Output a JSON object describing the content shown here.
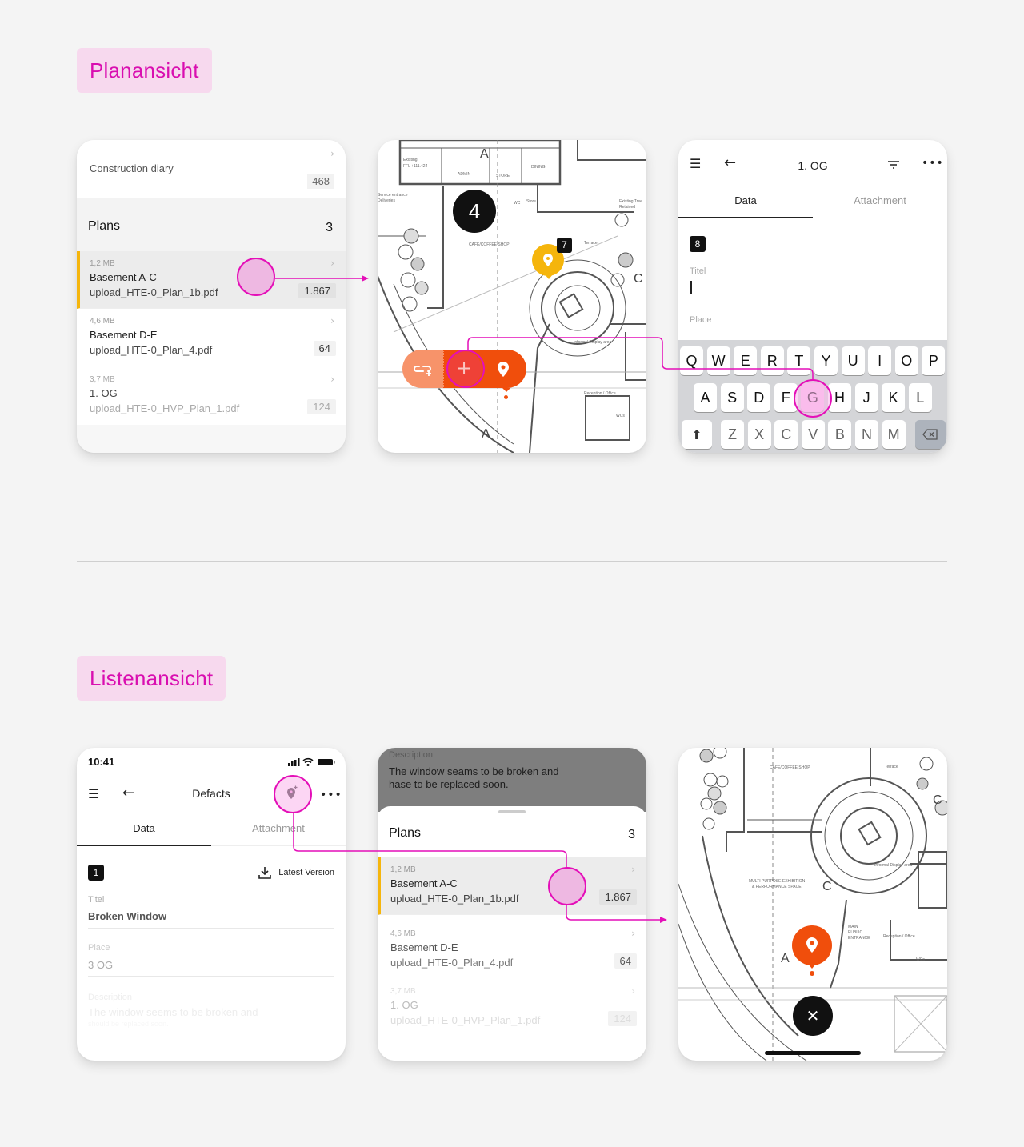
{
  "sections": {
    "plan_view": {
      "label": "Planansicht"
    },
    "list_view": {
      "label": "Listenansicht"
    }
  },
  "colors": {
    "accent_magenta": "#e40fb8",
    "tag_bg": "#f7d9ee",
    "marker_orange": "#f04e0c",
    "marker_yellow": "#f5b50c",
    "pill_light_orange": "#f7936a"
  },
  "screen1": {
    "diary_label": "Construction diary",
    "diary_count": "468",
    "plans_title": "Plans",
    "plans_count": "3",
    "items": [
      {
        "size": "1,2 MB",
        "name": "Basement A-C",
        "file": "upload_HTE-0_Plan_1b.pdf",
        "count": "1.867"
      },
      {
        "size": "4,6 MB",
        "name": "Basement D-E",
        "file": "upload_HTE-0_Plan_4.pdf",
        "count": "64"
      },
      {
        "size": "3,7 MB",
        "name": "1. OG",
        "file": "upload_HTE-0_HVP_Plan_1.pdf",
        "count": "124"
      }
    ]
  },
  "screen2": {
    "cluster_count": "4",
    "marker_badge": "7",
    "labels": {
      "cafe": "CAFE/COFFEE SHOP",
      "terrace": "Terrace",
      "service": "Service entrance",
      "deliveries": "Deliveries",
      "existing": "Existing",
      "ffl": "FFL +111.424",
      "admin": "ADMIN",
      "store": "STORE",
      "dining": "DINING",
      "wc": "WC",
      "store2": "Store",
      "existing_tree": "Existing Tree",
      "retained": "Retained",
      "informal": "Informal Display area",
      "reception": "Reception / Office",
      "wcs": "WCs",
      "section_a": "A",
      "section_c": "C"
    },
    "actions": [
      {
        "icon": "link-add-icon",
        "glyph": "⊕"
      },
      {
        "icon": "plus-icon",
        "glyph": "+"
      },
      {
        "icon": "pin-icon",
        "glyph": "⬤"
      }
    ]
  },
  "screen3": {
    "title": "1. OG",
    "tabs": [
      "Data",
      "Attachment"
    ],
    "number_badge": "8",
    "fields": {
      "titel_label": "Titel",
      "titel_value": "",
      "place_label": "Place"
    },
    "keyboard": {
      "row1": [
        "Q",
        "W",
        "E",
        "R",
        "T",
        "Y",
        "U",
        "I",
        "O",
        "P"
      ],
      "row2": [
        "A",
        "S",
        "D",
        "F",
        "G",
        "H",
        "J",
        "K",
        "L"
      ],
      "row3": [
        "Z",
        "X",
        "C",
        "V",
        "B",
        "N",
        "M"
      ],
      "pressed_key": "G"
    }
  },
  "screen4": {
    "time": "10:41",
    "title": "Defacts",
    "tabs": [
      "Data",
      "Attachment"
    ],
    "number_badge": "1",
    "latest_version": "Latest Version",
    "fields": {
      "titel_label": "Titel",
      "titel_value": "Broken Window",
      "place_label": "Place",
      "place_value": "3 OG",
      "description_label": "Description",
      "description_value": "The window seems to be broken and",
      "description_value_2": "should be replaced soon."
    }
  },
  "screen5": {
    "description_label": "Description",
    "description_value_1": "The window seams to be broken and",
    "description_value_2": "hase to be replaced soon.",
    "plans_title": "Plans",
    "plans_count": "3",
    "items": [
      {
        "size": "1,2 MB",
        "name": "Basement A-C",
        "file": "upload_HTE-0_Plan_1b.pdf",
        "count": "1.867"
      },
      {
        "size": "4,6 MB",
        "name": "Basement D-E",
        "file": "upload_HTE-0_Plan_4.pdf",
        "count": "64"
      },
      {
        "size": "3,7 MB",
        "name": "1. OG",
        "file": "upload_HTE-0_HVP_Plan_1.pdf",
        "count": "124"
      }
    ]
  },
  "screen6": {
    "labels": {
      "cafe": "CAFE/COFFEE SHOP",
      "terrace": "Terrace",
      "multi1": "MULTI PURPOSE EXHIBITION",
      "multi2": "& PERFORMANCE SPACE",
      "informal": "Informal Display area",
      "reception": "Reception / Office",
      "wcs": "WCs",
      "main1": "MAIN",
      "main2": "PUBLIC",
      "main3": "ENTRANCE",
      "section_a": "A",
      "section_c": "C"
    },
    "close_glyph": "✕"
  }
}
